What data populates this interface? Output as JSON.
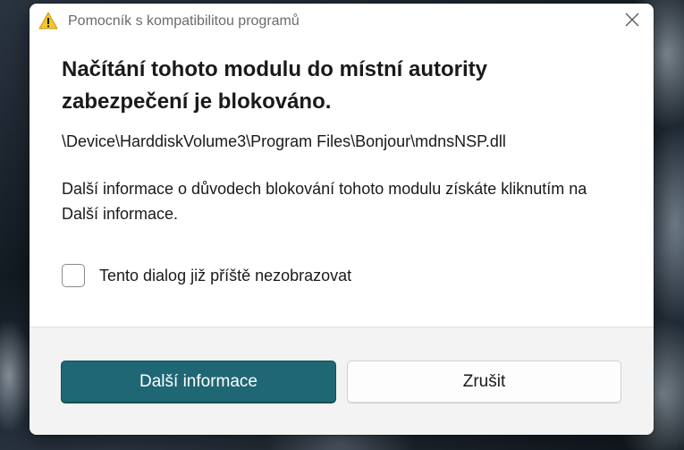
{
  "window": {
    "title": "Pomocník s kompatibilitou programů",
    "title_icon": "warning-icon",
    "close_icon": "close-icon"
  },
  "content": {
    "heading": "Načítání tohoto modulu do místní autority zabezpečení je blokováno.",
    "module_path": "\\Device\\HarddiskVolume3\\Program Files\\Bonjour\\mdnsNSP.dll",
    "info_text": "Další informace o důvodech blokování tohoto modulu získáte kliknutím na Další informace.",
    "checkbox": {
      "label": "Tento dialog již příště nezobrazovat",
      "checked": false
    }
  },
  "buttons": {
    "more_info": "Další informace",
    "cancel": "Zrušit"
  },
  "colors": {
    "primary_button": "#1f6774",
    "warning_icon": "#f4c430"
  }
}
